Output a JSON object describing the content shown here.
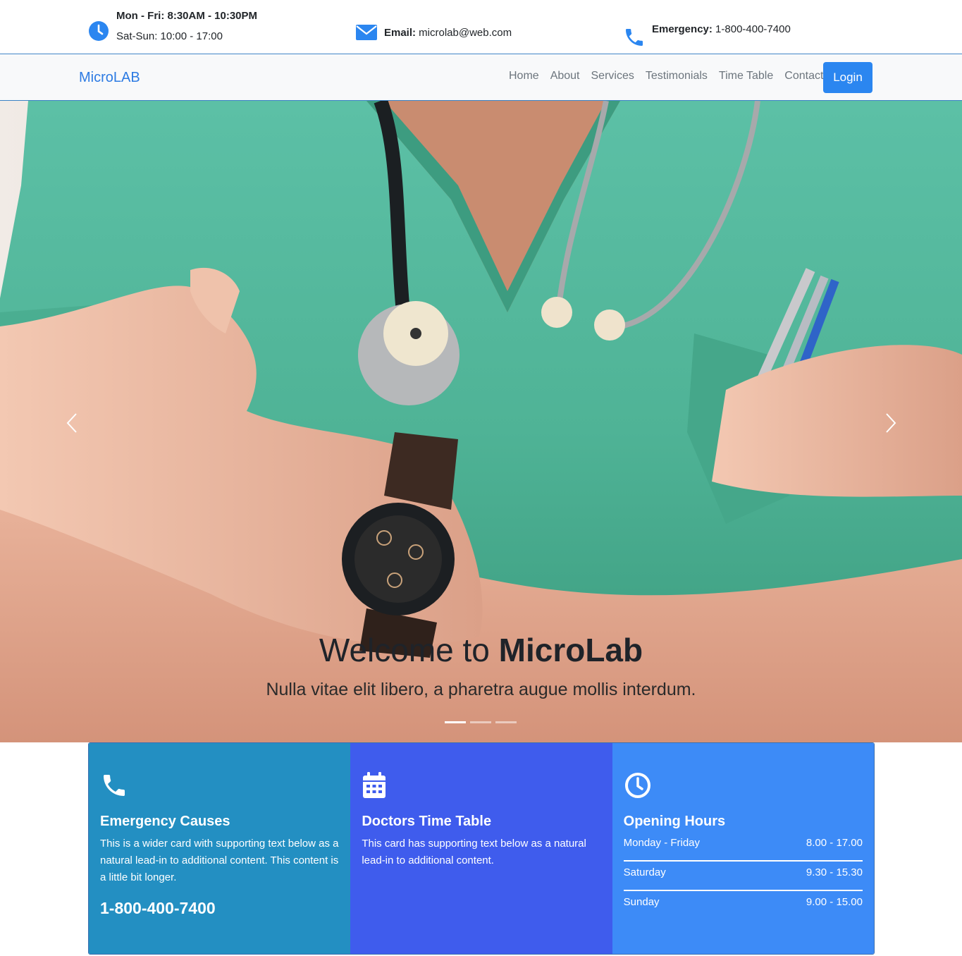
{
  "topbar": {
    "hours_line1": "Mon - Fri: 8:30AM - 10:30PM",
    "hours_line2": "Sat-Sun: 10:00 - 17:00",
    "email_label": "Email:",
    "email_value": " microlab@web.com",
    "emergency_label": "Emergency:",
    "emergency_value": " 1-800-400-7400",
    "icons": [
      "clock-icon",
      "envelope-icon",
      "phone-icon"
    ],
    "accent_color": "#2b86f0"
  },
  "navbar": {
    "brand": "MicroLAB",
    "links": [
      "Home",
      "About",
      "Services",
      "Testimonials",
      "Time Table",
      "Contact"
    ],
    "login_label": "Login"
  },
  "hero": {
    "title_plain": "Welcome to ",
    "title_bold": "MicroLab",
    "subtitle": "Nulla vitae elit libero, a pharetra augue mollis interdum.",
    "slides": 3,
    "active_slide": 1
  },
  "cards": [
    {
      "icon": "phone-icon",
      "title": "Emergency Causes",
      "text": "This is a wider card with supporting text below as a natural lead-in to additional content. This content is a little bit longer.",
      "phone": "1-800-400-7400",
      "color": "#238fc2"
    },
    {
      "icon": "calendar-icon",
      "title": "Doctors Time Table",
      "text": "This card has supporting text below as a natural lead-in to additional content.",
      "color": "#3f5ced"
    },
    {
      "icon": "clock-icon",
      "title": "Opening Hours",
      "color": "#3d8bf7",
      "hours": [
        {
          "day": "Monday - Friday",
          "time": "8.00 - 17.00"
        },
        {
          "day": "Saturday",
          "time": "9.30 - 15.30"
        },
        {
          "day": "Sunday",
          "time": "9.00 - 15.00"
        }
      ]
    }
  ]
}
